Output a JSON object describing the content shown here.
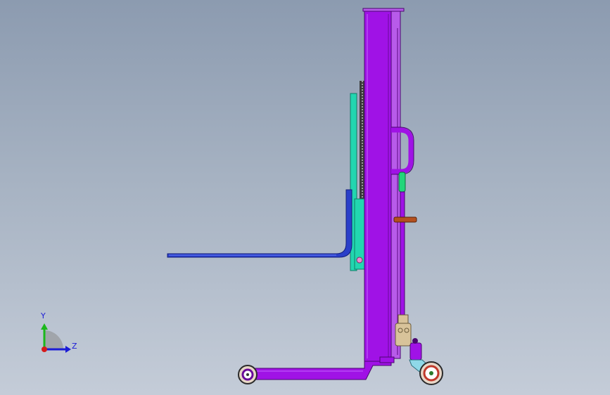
{
  "triad": {
    "y_label": "Y",
    "z_label": "Z"
  },
  "colors": {
    "mast": "#a012e6",
    "mast_dark": "#6a0a9a",
    "carriage": "#22d6b0",
    "carriage_dark": "#0f7d66",
    "fork": "#2a3fc9",
    "fork_dark": "#141f7a",
    "handle_bar": "#b4501e",
    "pump_body": "#d8c39a",
    "wheel_tread": "#e8d7c8",
    "axis_y": "#1bb81b",
    "axis_z": "#1b1bd6",
    "axis_x": "#d61b1b"
  },
  "icons": {
    "origin": "coordinate-triad-icon"
  }
}
